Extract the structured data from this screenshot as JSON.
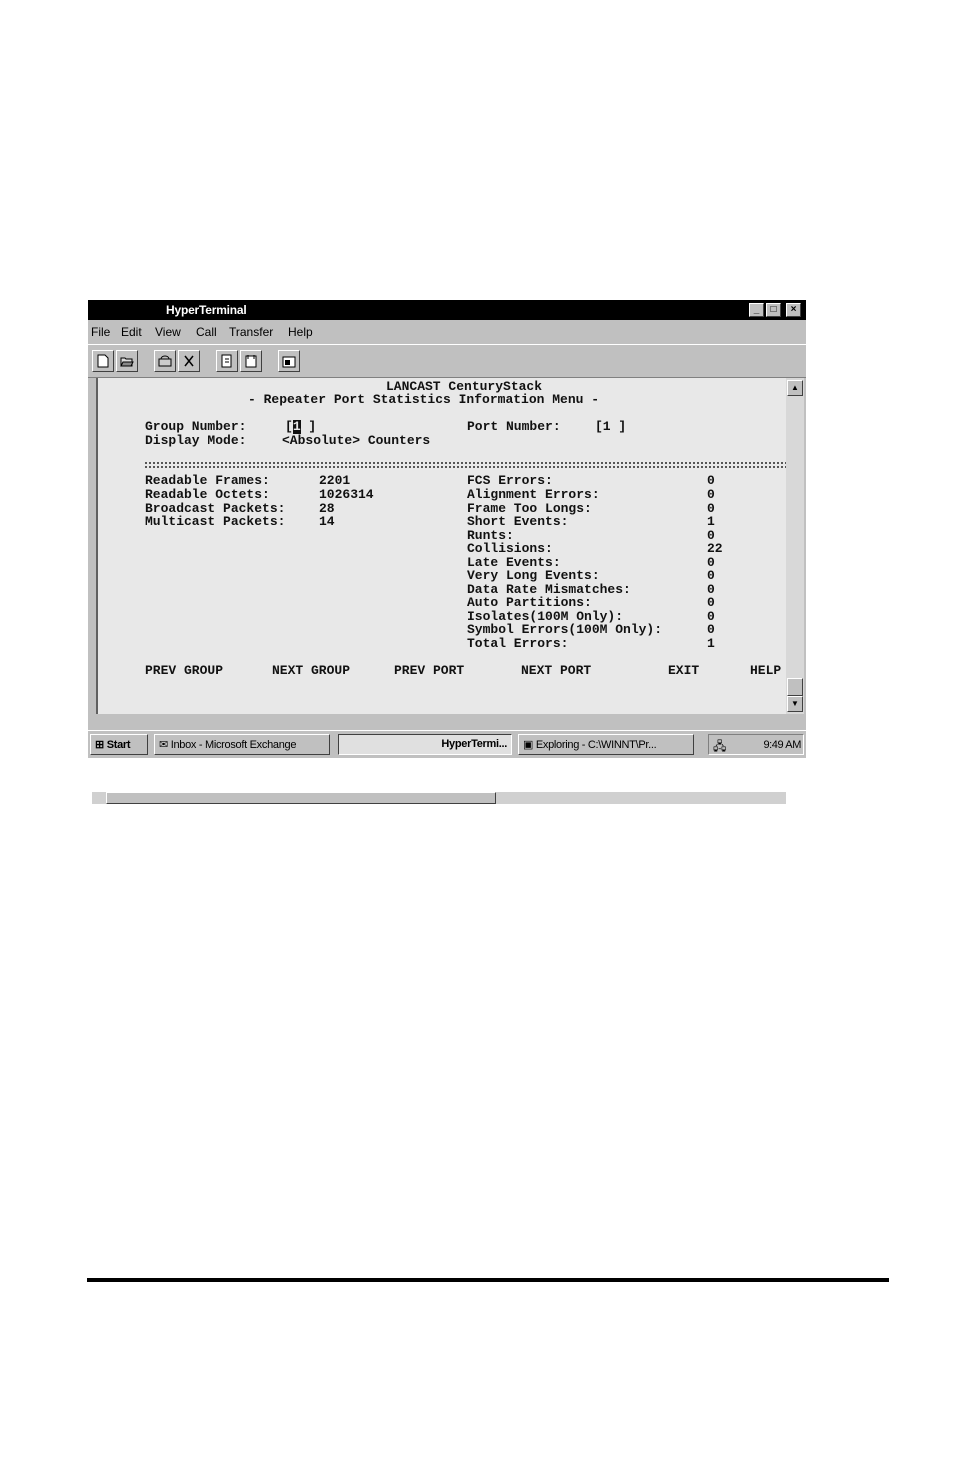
{
  "window": {
    "title": "HyperTerminal",
    "controls": {
      "minimize": "_",
      "maximize": "□",
      "close": "×"
    }
  },
  "menu": [
    "File",
    "Edit",
    "View",
    "Call",
    "Transfer",
    "Help"
  ],
  "toolbar_icons": [
    "new-icon",
    "open-icon",
    "connect-icon",
    "disconnect-icon",
    "send-icon",
    "receive-icon",
    "properties-icon"
  ],
  "terminal": {
    "heading1": "LANCAST CenturyStack",
    "heading2": "- Repeater Port Statistics Information Menu -",
    "group_label": "Group Number:",
    "group_value": "1",
    "port_label": "Port Number:",
    "port_value": "[1 ]",
    "display_label": "Display Mode:",
    "display_value": "<Absolute> Counters",
    "left_stats": [
      {
        "label": "Readable Frames:",
        "value": "2201"
      },
      {
        "label": "Readable Octets:",
        "value": "1026314"
      },
      {
        "label": "Broadcast Packets:",
        "value": "28"
      },
      {
        "label": "Multicast Packets:",
        "value": "14"
      }
    ],
    "right_stats": [
      {
        "label": "FCS Errors:",
        "value": "0"
      },
      {
        "label": "Alignment Errors:",
        "value": "0"
      },
      {
        "label": "Frame Too Longs:",
        "value": "0"
      },
      {
        "label": "Short Events:",
        "value": "1"
      },
      {
        "label": "Runts:",
        "value": "0"
      },
      {
        "label": "Collisions:",
        "value": "22"
      },
      {
        "label": "Late Events:",
        "value": "0"
      },
      {
        "label": "Very Long Events:",
        "value": "0"
      },
      {
        "label": "Data Rate Mismatches:",
        "value": "0"
      },
      {
        "label": "Auto Partitions:",
        "value": "0"
      },
      {
        "label": "Isolates(100M Only):",
        "value": "0"
      },
      {
        "label": "Symbol Errors(100M Only):",
        "value": "0"
      },
      {
        "label": "Total Errors:",
        "value": "1"
      }
    ],
    "commands": [
      "PREV GROUP",
      "NEXT GROUP",
      "PREV PORT",
      "NEXT PORT",
      "EXIT",
      "HELP"
    ]
  },
  "taskbar": {
    "start": "Start",
    "tasks": [
      "Inbox - Microsoft Exchange",
      "HyperTermi...",
      "Exploring - C:\\WINNT\\Pr..."
    ],
    "clock": "9:49 AM"
  }
}
